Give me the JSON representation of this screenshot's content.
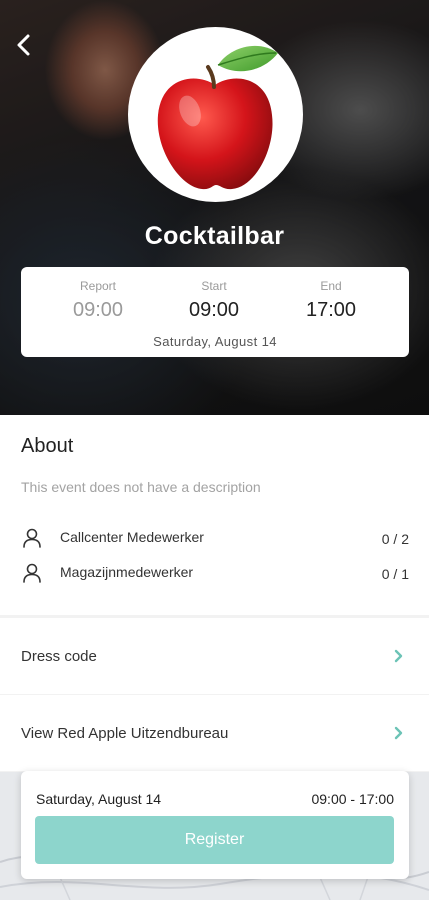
{
  "hero": {
    "title": "Cocktailbar",
    "times": {
      "report_label": "Report",
      "report_value": "09:00",
      "start_label": "Start",
      "start_value": "09:00",
      "end_label": "End",
      "end_value": "17:00",
      "date": "Saturday, August 14"
    },
    "logo_icon": "red-apple-icon"
  },
  "about": {
    "heading": "About",
    "description": "This event does not have a description",
    "roles": [
      {
        "name": "Callcenter Medewerker",
        "count": "0 / 2",
        "icon": "person-icon"
      },
      {
        "name": "Magazijnmedewerker",
        "count": "0 / 1",
        "icon": "person-icon"
      }
    ]
  },
  "links": {
    "dress_code": "Dress code",
    "view_agency": "View Red Apple Uitzendbureau"
  },
  "footer": {
    "date": "Saturday, August 14",
    "time_range": "09:00 - 17:00",
    "register_label": "Register"
  },
  "colors": {
    "accent": "#8dd5cc",
    "chevron": "#6cc3b6"
  }
}
